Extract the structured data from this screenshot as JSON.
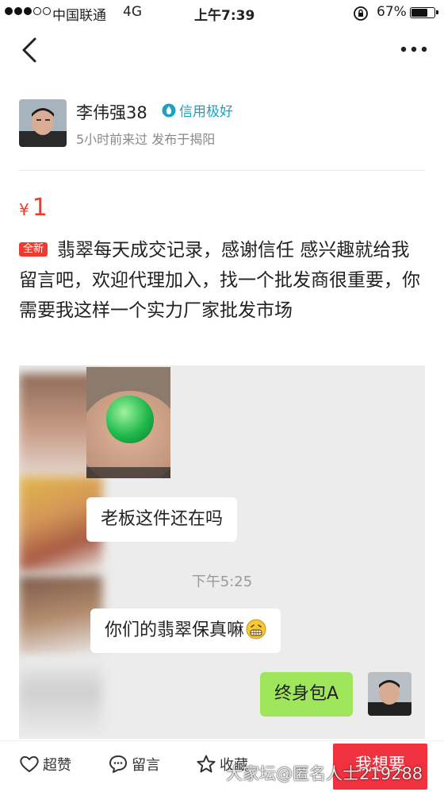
{
  "status_bar": {
    "carrier": "中国联通",
    "network": "4G",
    "time": "上午7:39",
    "battery_percent": "67%",
    "battery_level": 0.67
  },
  "nav": {
    "back_icon": "chevron-left-icon",
    "more_icon": "more-dots-icon"
  },
  "seller": {
    "name": "李伟强38",
    "credit_label": "信用极好",
    "meta": "5小时前来过 发布于揭阳"
  },
  "listing": {
    "currency_symbol": "¥",
    "price": "1",
    "tag": "全新",
    "description": "翡翠每天成交记录，感谢信任  感兴趣就给我留言吧，欢迎代理加入，找一个批发商很重要，你需要我这样一个实力厂家批发市场"
  },
  "chat": {
    "messages": [
      {
        "text": "老板这件还在吗"
      },
      {
        "time": "下午5:25"
      },
      {
        "text": "你们的翡翠保真嘛",
        "emoji": "grin-emoji"
      },
      {
        "text": "终身包A"
      }
    ],
    "colors": {
      "incoming": "#ffffff",
      "outgoing": "#9fe65c",
      "jade": "#22b84b"
    }
  },
  "bottom_bar": {
    "like_label": "超赞",
    "comment_label": "留言",
    "favorite_label": "收藏",
    "want_label": "我想要",
    "watermark": "大家坛@匿名人士219288"
  },
  "colors": {
    "price": "#f03a2e",
    "credit": "#1aa1c6",
    "want_button": "#f0313f"
  }
}
